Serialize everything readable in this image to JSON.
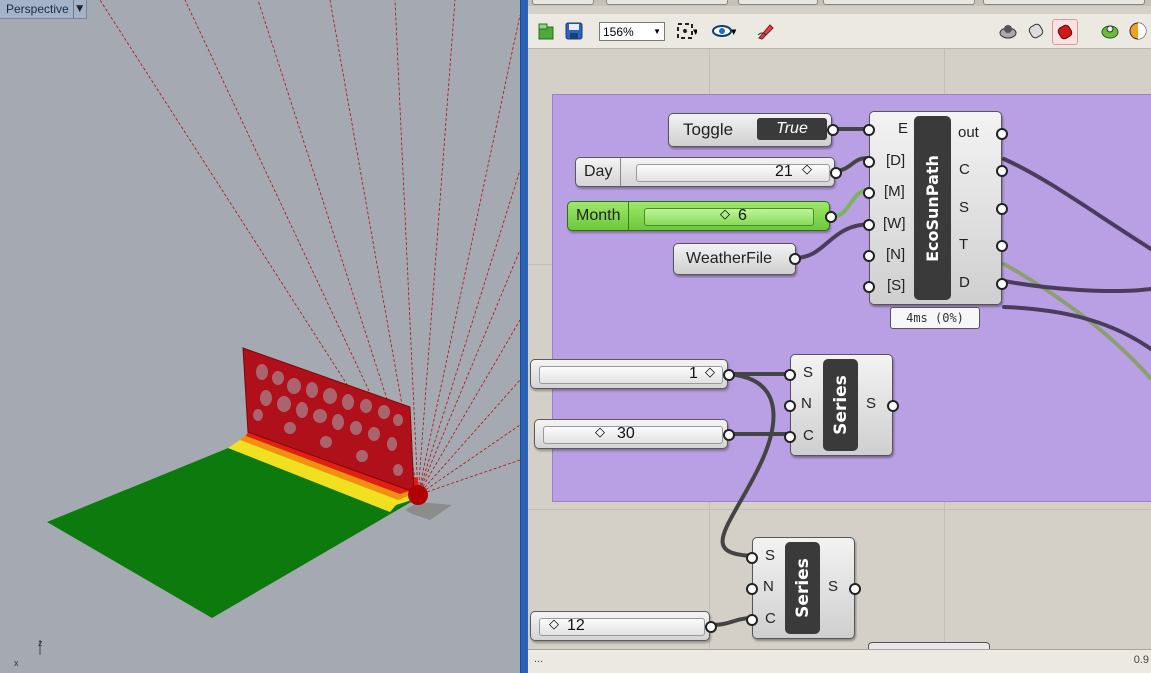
{
  "viewport": {
    "title": "Perspective",
    "axis_z": "z",
    "axis_x": "x"
  },
  "toolbar": {
    "zoom": "156%",
    "icons": [
      "new-file-icon",
      "save-icon",
      "zoom-extents-icon",
      "preview-eye-icon",
      "sketch-pen-icon",
      "wireframe-preview-icon",
      "shaded-preview-icon",
      "selected-preview-icon",
      "bake-icon",
      "material-icon"
    ]
  },
  "components": {
    "toggle": {
      "label": "Toggle",
      "value": "True"
    },
    "day": {
      "label": "Day",
      "value": "21"
    },
    "month": {
      "label": "Month",
      "value": "6"
    },
    "weatherfile": {
      "label": "WeatherFile"
    },
    "ecosunpath": {
      "title": "EcoSunPath",
      "inputs": [
        "E",
        "[D]",
        "[M]",
        "[W]",
        "[N]",
        "[S]"
      ],
      "outputs": [
        "out",
        "C",
        "S",
        "T",
        "D"
      ],
      "timing": "4ms (0%)"
    },
    "slider_1": {
      "value": "1"
    },
    "slider_30": {
      "value": "30"
    },
    "slider_12": {
      "value": "12"
    },
    "series_1": {
      "title": "Series",
      "inputs": [
        "S",
        "N",
        "C"
      ],
      "output": "S"
    },
    "series_2": {
      "title": "Series",
      "inputs": [
        "S",
        "N",
        "C"
      ],
      "output": "S"
    }
  },
  "status": {
    "left": "...",
    "right": "0.9"
  }
}
